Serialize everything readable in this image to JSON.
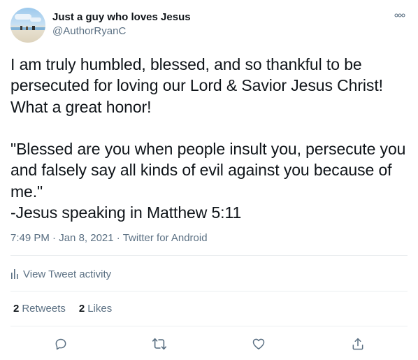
{
  "author": {
    "name": "Just a guy who loves Jesus",
    "handle": "@AuthorRyanC"
  },
  "tweet": {
    "text": "I am truly humbled, blessed, and so thankful to be persecuted for loving our Lord & Savior Jesus Christ! What a great honor!\n\n\"Blessed are you when people insult you, persecute you and falsely say all kinds of evil against you because of me.\"\n-Jesus speaking in Matthew 5:11",
    "time": "7:49 PM",
    "separator": " · ",
    "date": "Jan 8, 2021",
    "source": "Twitter for Android"
  },
  "activity": {
    "label": "View Tweet activity"
  },
  "stats": {
    "retweets_count": "2",
    "retweets_label": "Retweets",
    "likes_count": "2",
    "likes_label": "Likes"
  },
  "icons": {
    "more": "more-horizontal-icon",
    "activity": "bar-chart-icon",
    "reply": "reply-icon",
    "retweet": "retweet-icon",
    "like": "heart-icon",
    "share": "share-icon"
  },
  "colors": {
    "text": "#0f1419",
    "secondary": "#5b7083",
    "divider": "#ebeef0"
  }
}
